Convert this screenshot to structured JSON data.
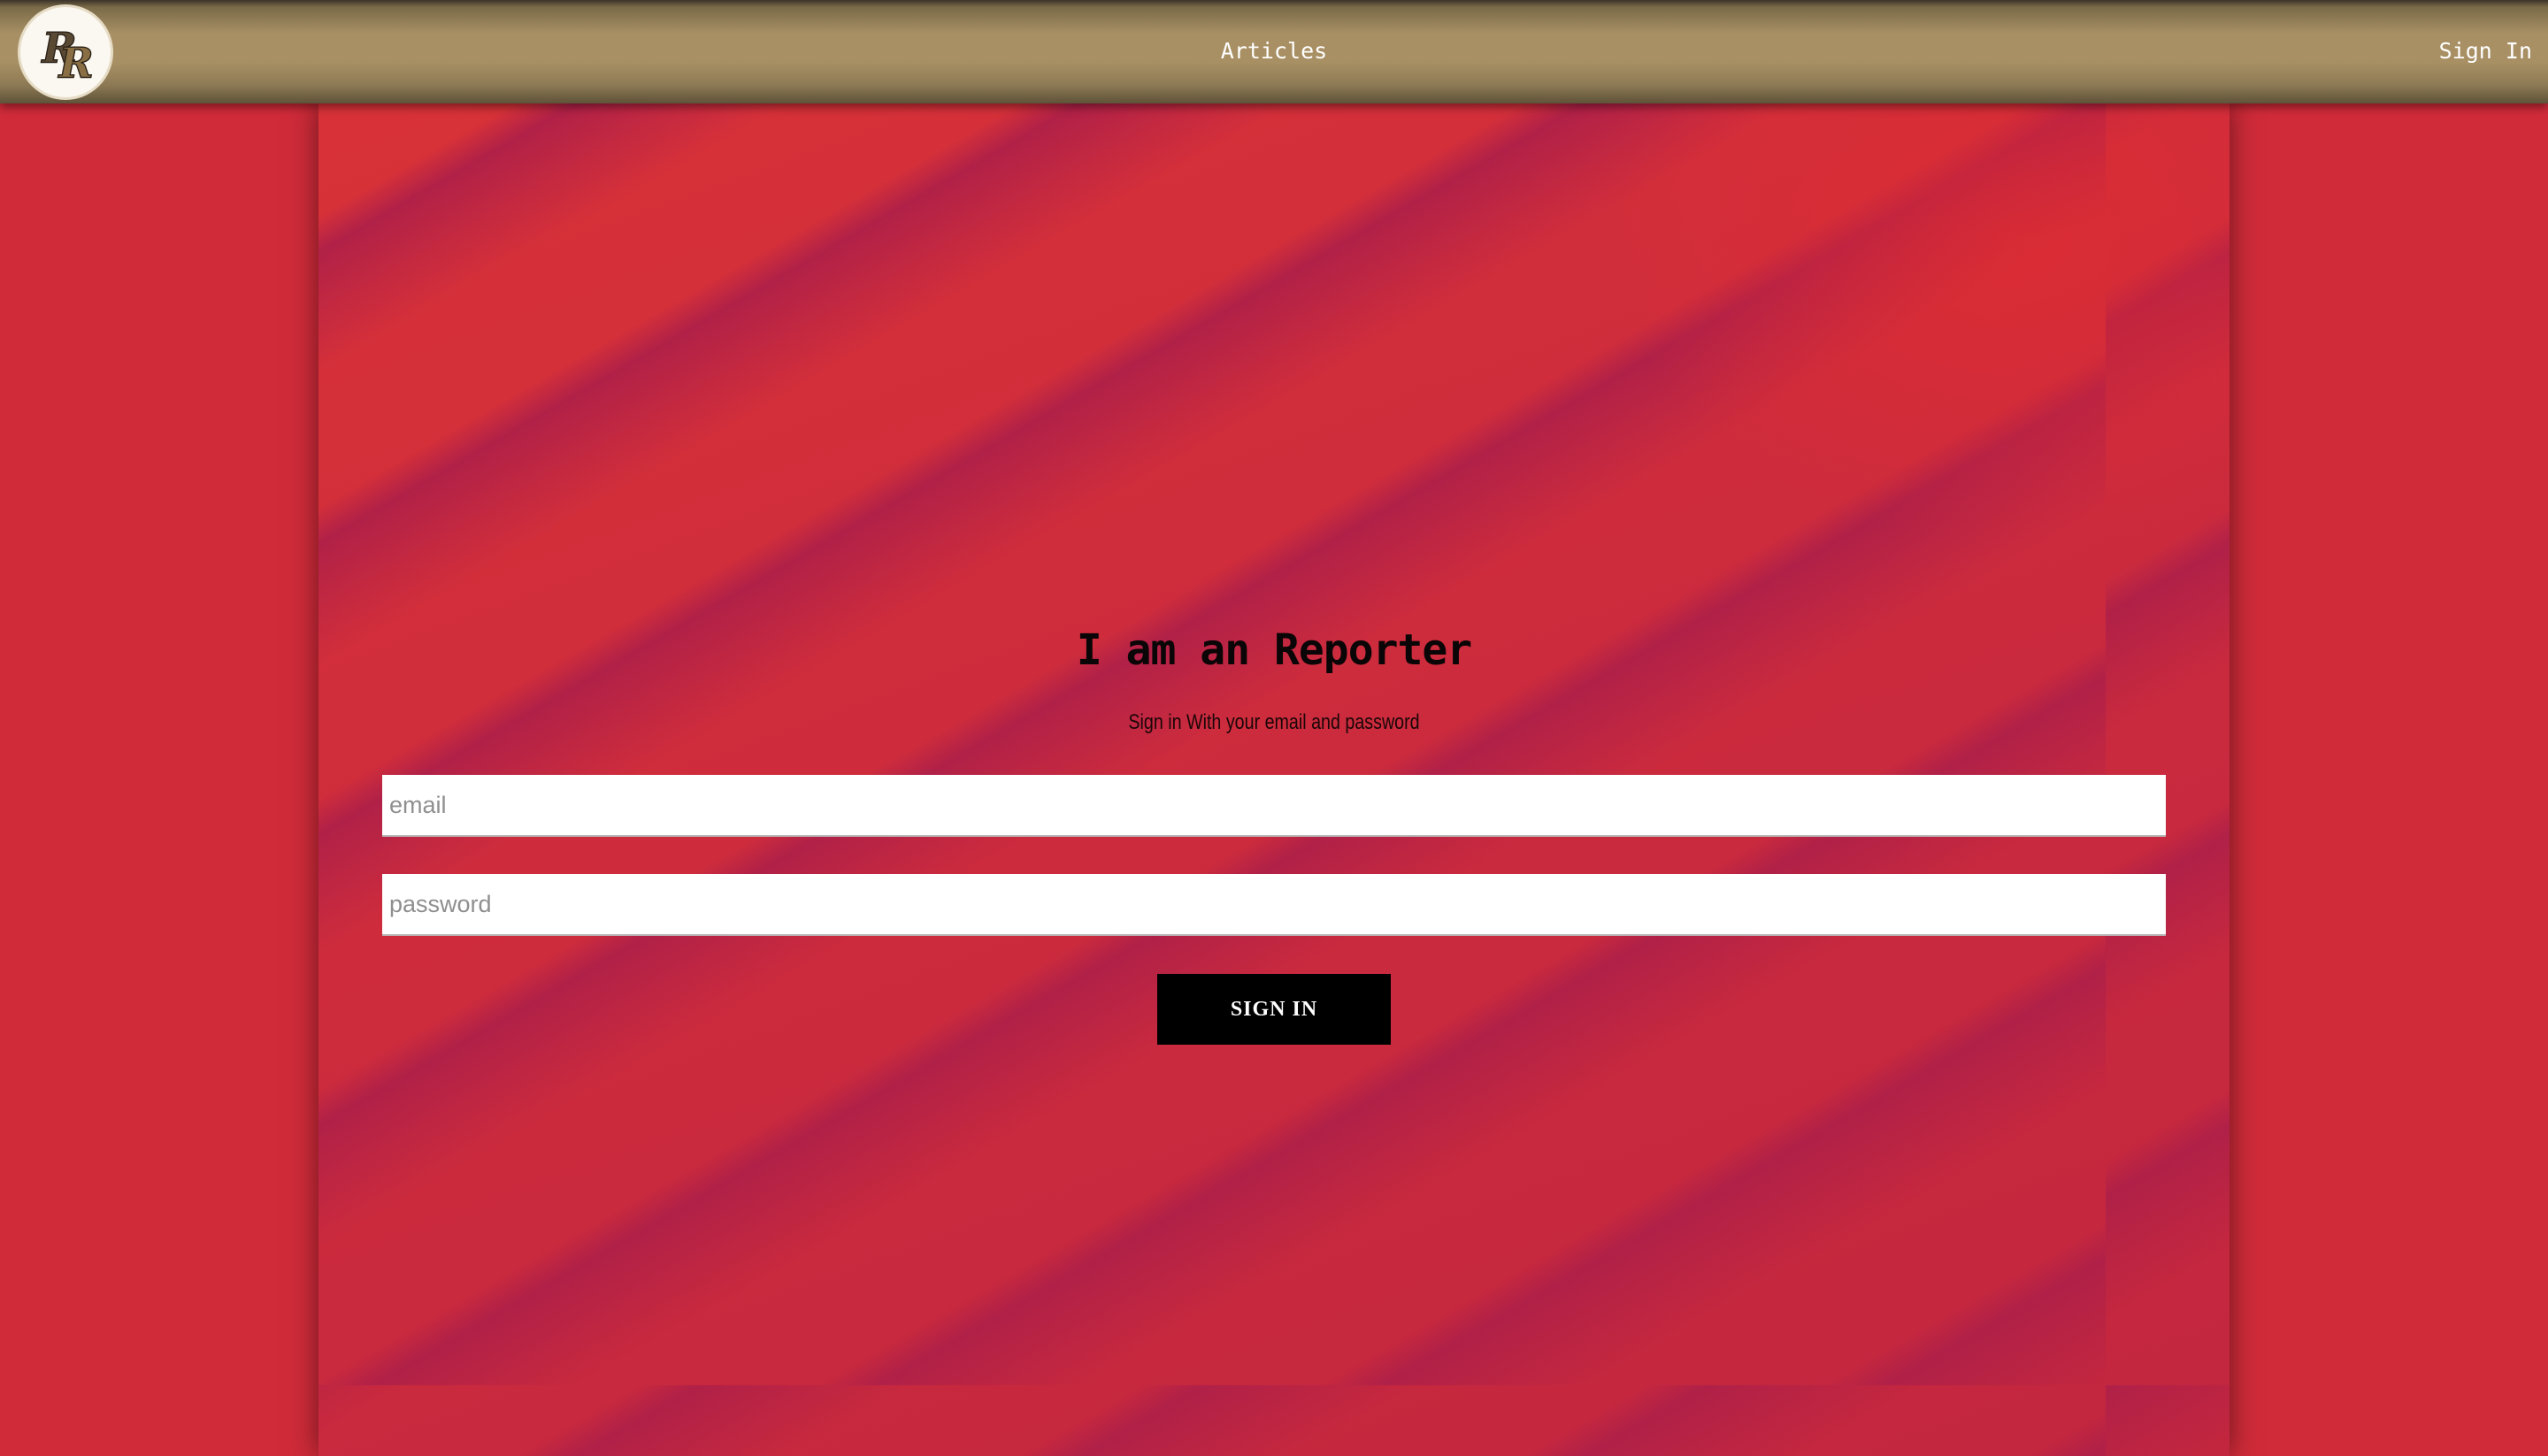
{
  "header": {
    "logo": {
      "letters": "RR",
      "icon": "rr-monogram-logo"
    },
    "nav": {
      "articles_label": "Articles",
      "signin_label": "Sign In"
    }
  },
  "form": {
    "title": "I am an Reporter",
    "subtitle": "Sign in With your email and password",
    "email": {
      "value": "",
      "placeholder": "email"
    },
    "password": {
      "value": "",
      "placeholder": "password"
    },
    "submit_label": "SIGN IN"
  },
  "colors": {
    "header": "#a89064",
    "background": "#d02b39",
    "stripe": "#b6223f",
    "button": "#000000",
    "button_text": "#ffffff"
  }
}
